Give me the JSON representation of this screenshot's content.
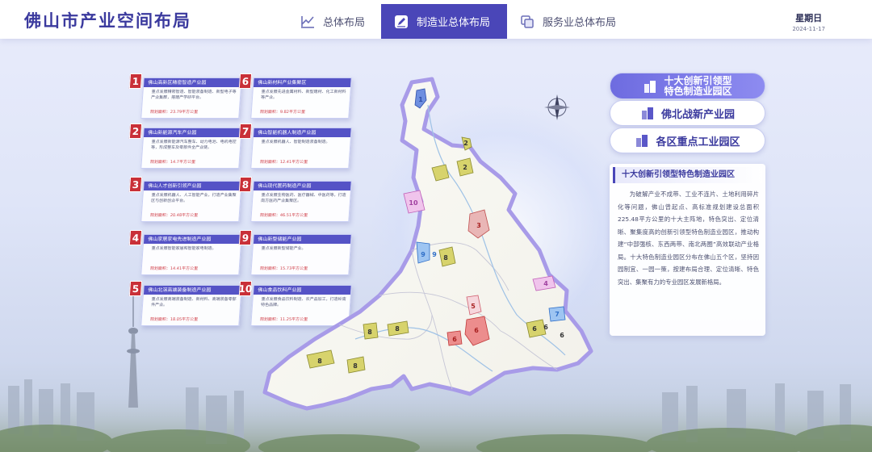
{
  "header": {
    "app_title": "佛山市产业空间布局",
    "tabs": [
      {
        "label": "总体布局",
        "icon": "chart-icon",
        "active": false
      },
      {
        "label": "制造业总体布局",
        "icon": "edit-icon",
        "active": true
      },
      {
        "label": "服务业总体布局",
        "icon": "layers-icon",
        "active": false
      }
    ],
    "weekday": "星期日",
    "date": "2024-11-17"
  },
  "cards": [
    {
      "num": "1",
      "title": "佛山高新区精密智造产业园",
      "desc": "重点发展精密智造、智能装备制造、新型电子等产业集群，搭建产学研平台。",
      "area": "规划面积：23.79平方公里"
    },
    {
      "num": "2",
      "title": "佛山新能源汽车产业园",
      "desc": "重点发展新能源汽车整车、动力电池、电机电控等，形成整车及零部件全产业链。",
      "area": "规划面积：14.7平方公里"
    },
    {
      "num": "3",
      "title": "佛山人才创新引领产业园",
      "desc": "重点发展机器人、人工智能产业，打造产业集聚区与创新创业平台。",
      "area": "规划面积：20.48平方公里"
    },
    {
      "num": "4",
      "title": "佛山家居家电先进制造产业园",
      "desc": "重点发展智能家居和智能家电制造。",
      "area": "规划面积：14.41平方公里"
    },
    {
      "num": "5",
      "title": "佛山北滘高端装备制造产业园",
      "desc": "重点发展高端装备制造、新材料、高端装备零部件产业。",
      "area": "规划面积：18.05平方公里"
    },
    {
      "num": "6",
      "title": "佛山新材料产业集聚区",
      "desc": "重点发展先进金属材料、新型建材、化工新材料等产业。",
      "area": "规划面积：9.82平方公里"
    },
    {
      "num": "7",
      "title": "佛山智能机器人制造产业园",
      "desc": "重点发展机器人、智能制造装备制造。",
      "area": "规划面积：12.41平方公里"
    },
    {
      "num": "8",
      "title": "佛山现代医药制造产业园",
      "desc": "重点发展生物医药、医疗器械、中医药等，打造南方医药产业集聚区。",
      "area": "规划面积：46.51平方公里"
    },
    {
      "num": "9",
      "title": "佛山新型储能产业园",
      "desc": "重点发展新型储能产业。",
      "area": "规划面积：15.73平方公里"
    },
    {
      "num": "10",
      "title": "佛山食品饮料产业园",
      "desc": "重点发展食品饮料制造、农产品加工，打造岭南特色品牌。",
      "area": "规划面积：11.25平方公里"
    }
  ],
  "map": {
    "labels": [
      "1",
      "2",
      "2",
      "3",
      "4",
      "5",
      "6",
      "6",
      "6",
      "6",
      "6",
      "7",
      "8",
      "8",
      "8",
      "8",
      "8",
      "9",
      "9",
      "10"
    ]
  },
  "right_buttons": [
    {
      "label": "十大创新引领型\n特色制造业园区",
      "active": true
    },
    {
      "label": "佛北战新产业园",
      "active": false
    },
    {
      "label": "各区重点工业园区",
      "active": false
    }
  ],
  "info_panel": {
    "title": "十大创新引领型特色制造业园区",
    "body": "为破解产业不成带、工业不连片、土地利用碎片化等问题，佛山曾起点、高标准规划建设总面积225.48平方公里的十大主阵地，特色突出、定位清晰、聚集度高的创新引领型特色制造业园区，推动构建“中部强核、东西两带、南北两圈”高效联动产业格局。十大特色制造业园区分布在佛山五个区，坚持因园制宜、一园一策，按建布局合理、定位清晰、特色突出、集聚有力的专业园区发展新格局。"
  },
  "colors": {
    "primary": "#4a46b8",
    "accent_red": "#c93038",
    "card_header": "#5553c6"
  }
}
